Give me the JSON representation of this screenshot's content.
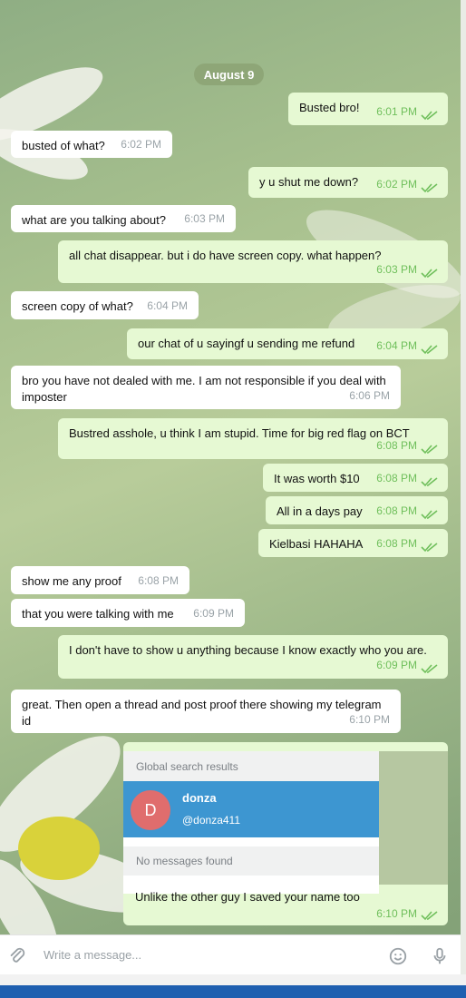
{
  "date_label": "August 9",
  "messages": [
    {
      "dir": "out",
      "text": "Busted bro!",
      "time": "6:01 PM"
    },
    {
      "dir": "in",
      "text": "busted of what?",
      "time": "6:02 PM"
    },
    {
      "dir": "out",
      "text": "y u shut me down?",
      "time": "6:02 PM"
    },
    {
      "dir": "in",
      "text": "what are you talking about?",
      "time": "6:03 PM"
    },
    {
      "dir": "out",
      "text": "all chat disappear.  but i do have screen copy. what happen?",
      "time": "6:03 PM"
    },
    {
      "dir": "in",
      "text": "screen copy of what?",
      "time": "6:04 PM"
    },
    {
      "dir": "out",
      "text": "our chat of u sayingf u sending me refund",
      "time": "6:04 PM"
    },
    {
      "dir": "in",
      "text": "bro you have not dealed with me. I am not responsible if you deal with imposter",
      "time": "6:06 PM"
    },
    {
      "dir": "out",
      "text": "Bustred asshole, u think I am stupid.  Time for big red flag on BCT",
      "time": "6:08 PM"
    },
    {
      "dir": "out",
      "text": "It was worth $10",
      "time": "6:08 PM"
    },
    {
      "dir": "out",
      "text": "All in a days pay",
      "time": "6:08 PM"
    },
    {
      "dir": "out",
      "text": "Kielbasi HAHAHA",
      "time": "6:08 PM"
    },
    {
      "dir": "in",
      "text": "show me any proof",
      "time": "6:08 PM"
    },
    {
      "dir": "in",
      "text": "that you were talking with me",
      "time": "6:09 PM"
    },
    {
      "dir": "out",
      "text": "I don't have to show u anything because I know exactly who you are.",
      "time": "6:09 PM"
    },
    {
      "dir": "in",
      "text": "great. Then open a thread and post proof there showing my telegram id",
      "time": "6:10 PM"
    }
  ],
  "screenshot_card": {
    "header": "Global search results",
    "avatar_letter": "D",
    "name": "donza",
    "username": "@donza411",
    "empty_text": "No messages found",
    "caption": "Unlike the other guy I saved your name too",
    "time": "6:10 PM"
  },
  "composer": {
    "placeholder": "Write a message..."
  },
  "colors": {
    "outgoing_bubble": "#e6f9d3",
    "incoming_bubble": "#ffffff",
    "read_ticks": "#6fbf5b"
  }
}
